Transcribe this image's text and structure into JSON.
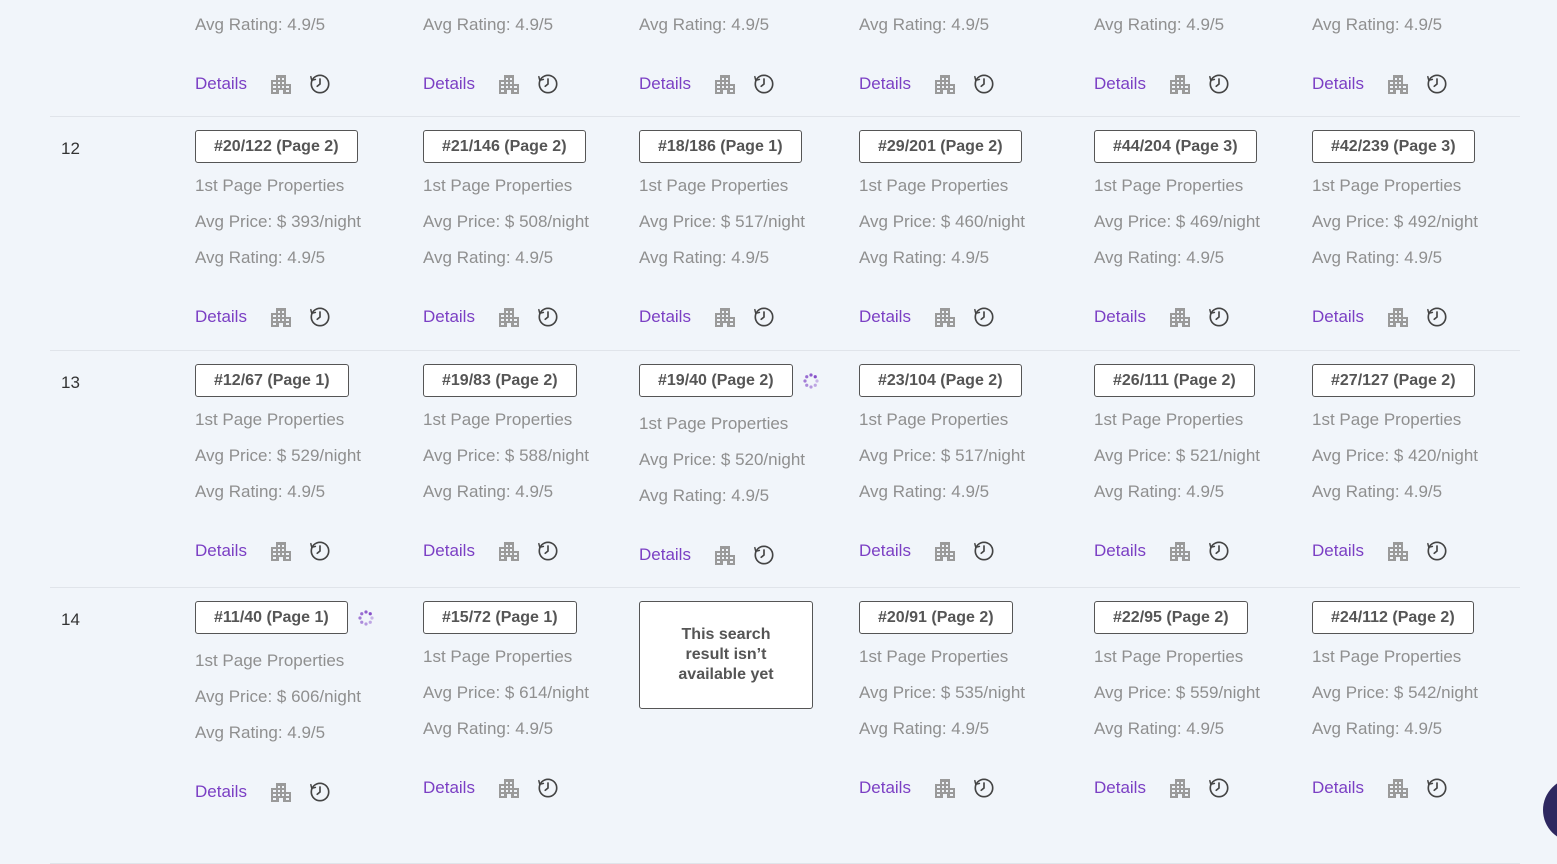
{
  "labels": {
    "first_page": "1st Page Properties",
    "avg_price_prefix": "Avg Price: $ ",
    "avg_price_suffix": "/night",
    "avg_rating_prefix": "Avg Rating: ",
    "details": "Details",
    "not_available": "This search result isn’t available yet"
  },
  "colors": {
    "accent": "#7b3fc4",
    "background": "#f1f5fa",
    "fab": "#2e2860"
  },
  "icons": {
    "building": "building-icon",
    "history": "history-clock-icon",
    "loading": "loading-spinner-icon"
  },
  "partial_row": {
    "cells": [
      {
        "rating": "4.9/5"
      },
      {
        "rating": "4.9/5"
      },
      {
        "rating": "4.9/5"
      },
      {
        "rating": "4.9/5"
      },
      {
        "rating": "4.9/5"
      },
      {
        "rating": "4.9/5"
      }
    ]
  },
  "rows": [
    {
      "number": "12",
      "cells": [
        {
          "rank": "#20/122 (Page 2)",
          "price": "393",
          "rating": "4.9/5"
        },
        {
          "rank": "#21/146 (Page 2)",
          "price": "508",
          "rating": "4.9/5"
        },
        {
          "rank": "#18/186 (Page 1)",
          "price": "517",
          "rating": "4.9/5"
        },
        {
          "rank": "#29/201 (Page 2)",
          "price": "460",
          "rating": "4.9/5"
        },
        {
          "rank": "#44/204 (Page 3)",
          "price": "469",
          "rating": "4.9/5"
        },
        {
          "rank": "#42/239 (Page 3)",
          "price": "492",
          "rating": "4.9/5"
        }
      ]
    },
    {
      "number": "13",
      "cells": [
        {
          "rank": "#12/67 (Page 1)",
          "price": "529",
          "rating": "4.9/5"
        },
        {
          "rank": "#19/83 (Page 2)",
          "price": "588",
          "rating": "4.9/5"
        },
        {
          "rank": "#19/40 (Page 2)",
          "price": "520",
          "rating": "4.9/5",
          "loading": true
        },
        {
          "rank": "#23/104 (Page 2)",
          "price": "517",
          "rating": "4.9/5"
        },
        {
          "rank": "#26/111 (Page 2)",
          "price": "521",
          "rating": "4.9/5"
        },
        {
          "rank": "#27/127 (Page 2)",
          "price": "420",
          "rating": "4.9/5"
        }
      ]
    },
    {
      "number": "14",
      "cells": [
        {
          "rank": "#11/40 (Page 1)",
          "price": "606",
          "rating": "4.9/5",
          "loading": true
        },
        {
          "rank": "#15/72 (Page 1)",
          "price": "614",
          "rating": "4.9/5"
        },
        {
          "unavailable": true
        },
        {
          "rank": "#20/91 (Page 2)",
          "price": "535",
          "rating": "4.9/5"
        },
        {
          "rank": "#22/95 (Page 2)",
          "price": "559",
          "rating": "4.9/5"
        },
        {
          "rank": "#24/112 (Page 2)",
          "price": "542",
          "rating": "4.9/5"
        }
      ]
    }
  ]
}
